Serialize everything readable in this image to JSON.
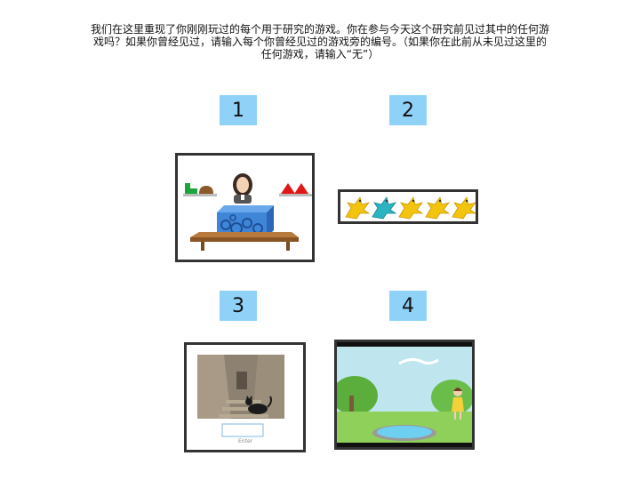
{
  "instructions": "我们在这里重现了你刚刚玩过的每个用于研究的游戏。你在参与今天这个研究前见过其中的任何游\n戏吗？如果你曾经见过，请输入每个你曾经见过的游戏旁的编号。（如果你在此前从未见过这里的\n任何游戏，请输入“无”）",
  "games": [
    {
      "number": "1",
      "icon": "blicket-machine-game"
    },
    {
      "number": "2",
      "icon": "dinosaur-row-game"
    },
    {
      "number": "3",
      "icon": "cat-photo-game",
      "caption": "Enter"
    },
    {
      "number": "4",
      "icon": "cartoon-park-game"
    }
  ],
  "colors": {
    "badge": "#8fd1f7",
    "frame": "#333333",
    "box": "#3f86d8"
  }
}
